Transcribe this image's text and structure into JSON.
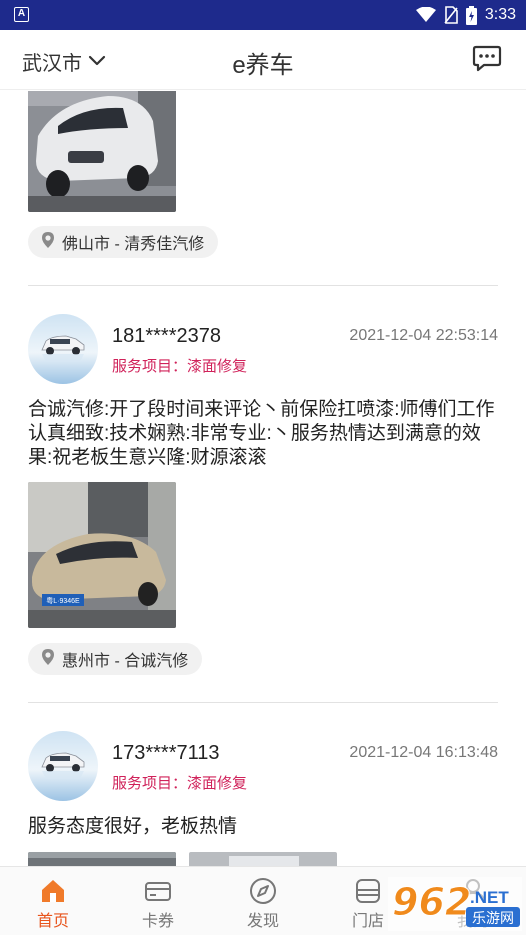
{
  "status_bar": {
    "time": "3:33"
  },
  "header": {
    "city": "武汉市",
    "title": "e养车"
  },
  "feed": {
    "item0": {
      "location": "佛山市 - 清秀佳汽修"
    },
    "item1": {
      "phone": "181****2378",
      "time": "2021-12-04 22:53:14",
      "service_label": "服务项目：",
      "service_value": "漆面修复",
      "review": "合诚汽修:开了段时间来评论丶前保险扛喷漆:师傅们工作认真细致:技术娴熟:非常专业:丶服务热情达到满意的效果:祝老板生意兴隆:财源滚滚",
      "plate": "粤L·9346E",
      "location": "惠州市 - 合诚汽修"
    },
    "item2": {
      "phone": "173****7113",
      "time": "2021-12-04 16:13:48",
      "service_label": "服务项目：",
      "service_value": "漆面修复",
      "review": "服务态度很好，老板热情"
    }
  },
  "tabbar": {
    "tabs": [
      {
        "label": "首页",
        "icon": "home-icon",
        "active": true
      },
      {
        "label": "卡券",
        "icon": "card-icon",
        "active": false
      },
      {
        "label": "发现",
        "icon": "compass-icon",
        "active": false
      },
      {
        "label": "门店",
        "icon": "store-icon",
        "active": false
      },
      {
        "label": "我的",
        "icon": "person-icon",
        "active": false
      }
    ]
  },
  "watermark": {
    "text": "962",
    "suffix": ".NET",
    "subtitle": "乐游网"
  },
  "colors": {
    "status_bar": "#1e2a8c",
    "accent": "#e8541c",
    "service": "#d0225a"
  }
}
